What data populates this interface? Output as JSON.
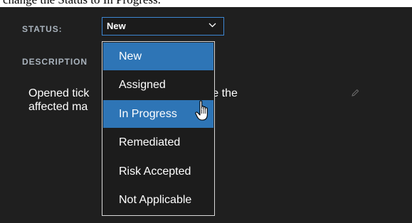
{
  "caption": "change the Status to In Progress.",
  "status": {
    "label": "STATUS:",
    "value": "New",
    "options": [
      "New",
      "Assigned",
      "In Progress",
      "Remediated",
      "Risk Accepted",
      "Not Applicable"
    ],
    "highlighted": [
      "New",
      "In Progress"
    ]
  },
  "description": {
    "label": "DESCRIPTION",
    "text_before": "Opened tick",
    "text_line1_right": "e-image the",
    "text_line2": "affected ma"
  },
  "colors": {
    "panel_bg": "#1f1f1f",
    "select_border": "#3d87d3",
    "highlight": "#2e75b6",
    "label_gray": "#a9b3bd"
  },
  "icons": {
    "select_arrow": "chevron-down-icon",
    "edit": "pencil-icon",
    "cursor": "hand-pointer-icon"
  }
}
